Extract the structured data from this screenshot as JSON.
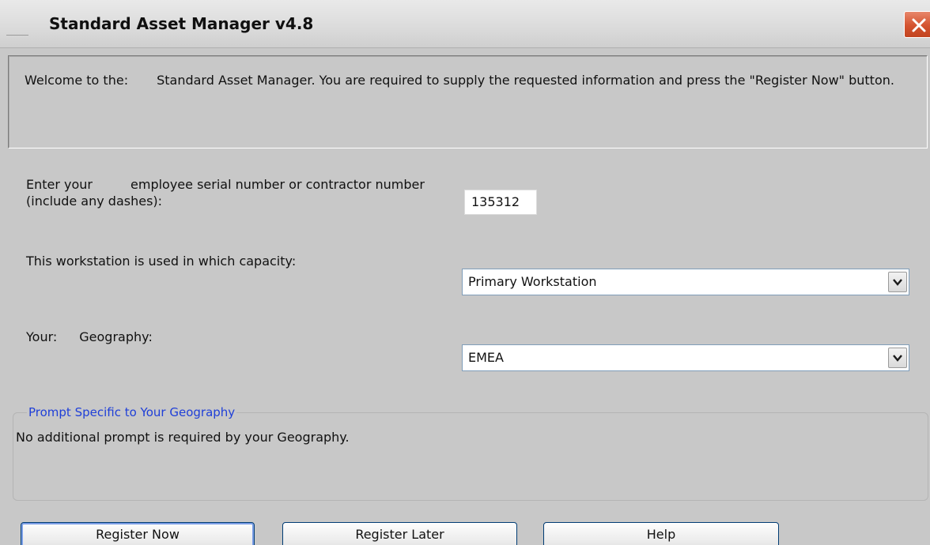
{
  "window": {
    "title": "Standard Asset Manager v4.8"
  },
  "welcome": {
    "prefix": "Welcome to the",
    "blank_mark": ":",
    "suffix": "Standard Asset Manager. You are required to supply the requested information and press the \"Register Now\" button."
  },
  "serial": {
    "label_prefix": "Enter your",
    "label_suffix": "employee serial number or contractor number (include any dashes):",
    "value": "135312"
  },
  "capacity": {
    "label": "This workstation is used in which capacity:",
    "selected": "Primary Workstation"
  },
  "geography": {
    "label_prefix": "Your",
    "blank_mark": ":",
    "label_suffix": "Geography:",
    "selected": "EMEA"
  },
  "prompt_group": {
    "legend": "Prompt Specific to Your Geography",
    "text": "No additional prompt is required by your Geography."
  },
  "buttons": {
    "register_now": "Register Now",
    "register_later": "Register Later",
    "help": "Help"
  },
  "icons": {
    "close": "close-icon",
    "dropdown": "chevron-down-icon"
  },
  "colors": {
    "close_button": "#d4532f",
    "legend_text": "#1f3fd8",
    "button_border": "#003c74"
  }
}
